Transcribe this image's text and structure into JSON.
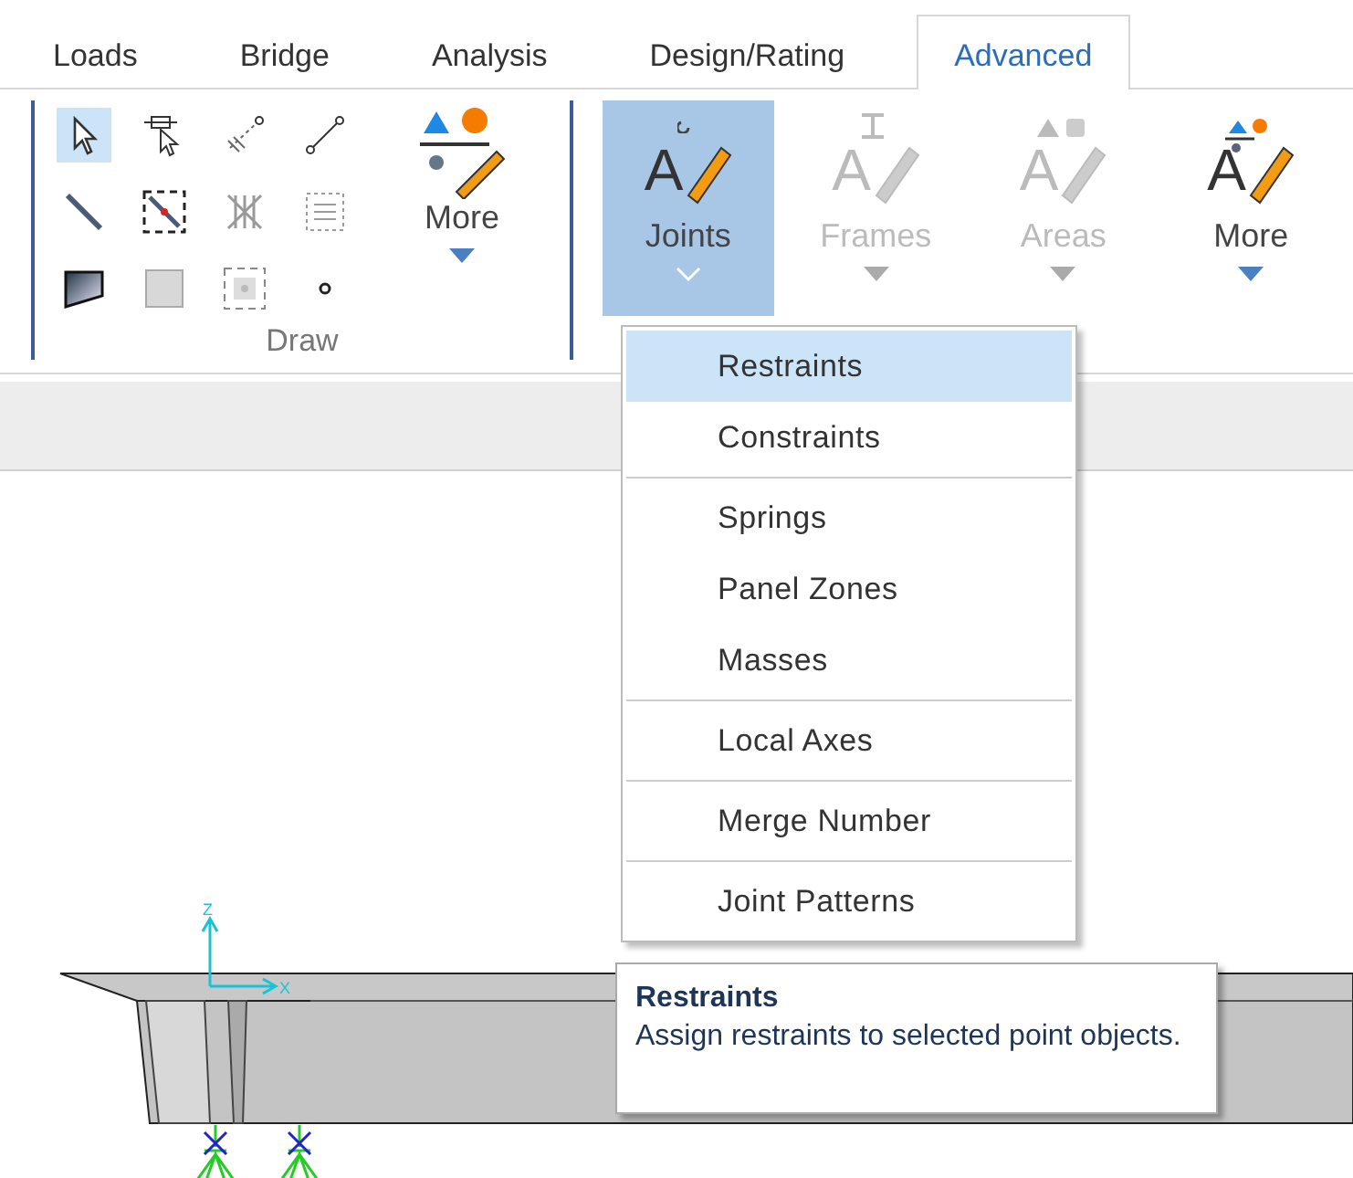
{
  "tabs": [
    {
      "label": "Loads",
      "selected": false
    },
    {
      "label": "Bridge",
      "selected": false
    },
    {
      "label": "Analysis",
      "selected": false
    },
    {
      "label": "Design/Rating",
      "selected": false
    },
    {
      "label": "Advanced",
      "selected": true
    }
  ],
  "draw_group": {
    "label": "Draw",
    "more": "More",
    "tools": [
      {
        "kind": "pointer",
        "selected": true
      },
      {
        "kind": "reshape",
        "selected": false
      },
      {
        "kind": "multi-line",
        "selected": false
      },
      {
        "kind": "link",
        "selected": false
      },
      {
        "kind": "line",
        "selected": false
      },
      {
        "kind": "section-line",
        "selected": false
      },
      {
        "kind": "grid",
        "selected": false
      },
      {
        "kind": "list-box",
        "selected": false
      },
      {
        "kind": "area",
        "selected": false
      },
      {
        "kind": "square",
        "selected": false
      },
      {
        "kind": "dashed-square",
        "selected": false
      },
      {
        "kind": "dot",
        "selected": false
      }
    ]
  },
  "buttons": [
    {
      "label": "Joints",
      "glyph": "A",
      "kind": "joints",
      "selected": true,
      "disabled": false
    },
    {
      "label": "Frames",
      "glyph": "A",
      "kind": "frames",
      "selected": false,
      "disabled": true
    },
    {
      "label": "Areas",
      "glyph": "A",
      "kind": "areas",
      "selected": false,
      "disabled": true
    },
    {
      "label": "More",
      "glyph": "A",
      "kind": "more",
      "selected": false,
      "disabled": false
    }
  ],
  "menu": {
    "groups": [
      {
        "items": [
          {
            "label": "Restraints",
            "selected": true
          },
          {
            "label": "Constraints",
            "selected": false
          }
        ]
      },
      {
        "items": [
          {
            "label": "Springs",
            "selected": false
          },
          {
            "label": "Panel Zones",
            "selected": false
          },
          {
            "label": "Masses",
            "selected": false
          }
        ]
      },
      {
        "items": [
          {
            "label": "Local Axes",
            "selected": false
          }
        ]
      },
      {
        "items": [
          {
            "label": "Merge Number",
            "selected": false
          }
        ]
      },
      {
        "items": [
          {
            "label": "Joint Patterns",
            "selected": false
          }
        ]
      }
    ]
  },
  "tooltip": {
    "title": "Restraints",
    "text": "Assign restraints to selected point objects."
  },
  "model": {
    "axes": [
      "Z",
      "X"
    ]
  }
}
